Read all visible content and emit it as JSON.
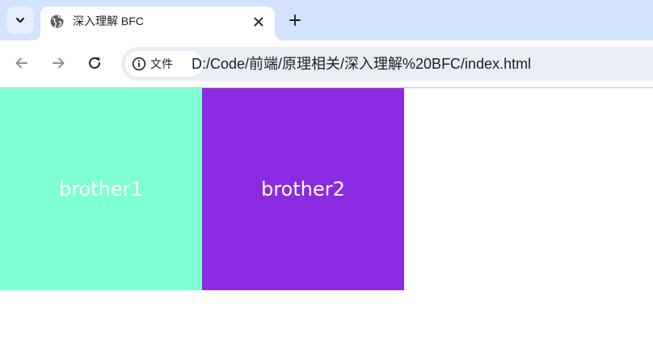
{
  "tab": {
    "title": "深入理解 BFC",
    "favicon": "globe-icon",
    "close": "close-icon"
  },
  "tabstrip": {
    "search_icon": "chevron-down-icon",
    "new_tab_icon": "plus-icon"
  },
  "toolbar": {
    "back_icon": "arrow-left-icon",
    "forward_icon": "arrow-right-icon",
    "reload_icon": "reload-icon"
  },
  "omnibox": {
    "chip_icon": "info-icon",
    "chip_label": "文件",
    "url": "D:/Code/前端/原理相关/深入理解%20BFC/index.html"
  },
  "page": {
    "boxes": [
      {
        "label": "brother1",
        "color": "#7fffd4"
      },
      {
        "label": "brother2",
        "color": "#8a2be2"
      }
    ]
  },
  "colors": {
    "tabstrip": "#d3e3fd",
    "omnibox": "#e9eef6"
  }
}
